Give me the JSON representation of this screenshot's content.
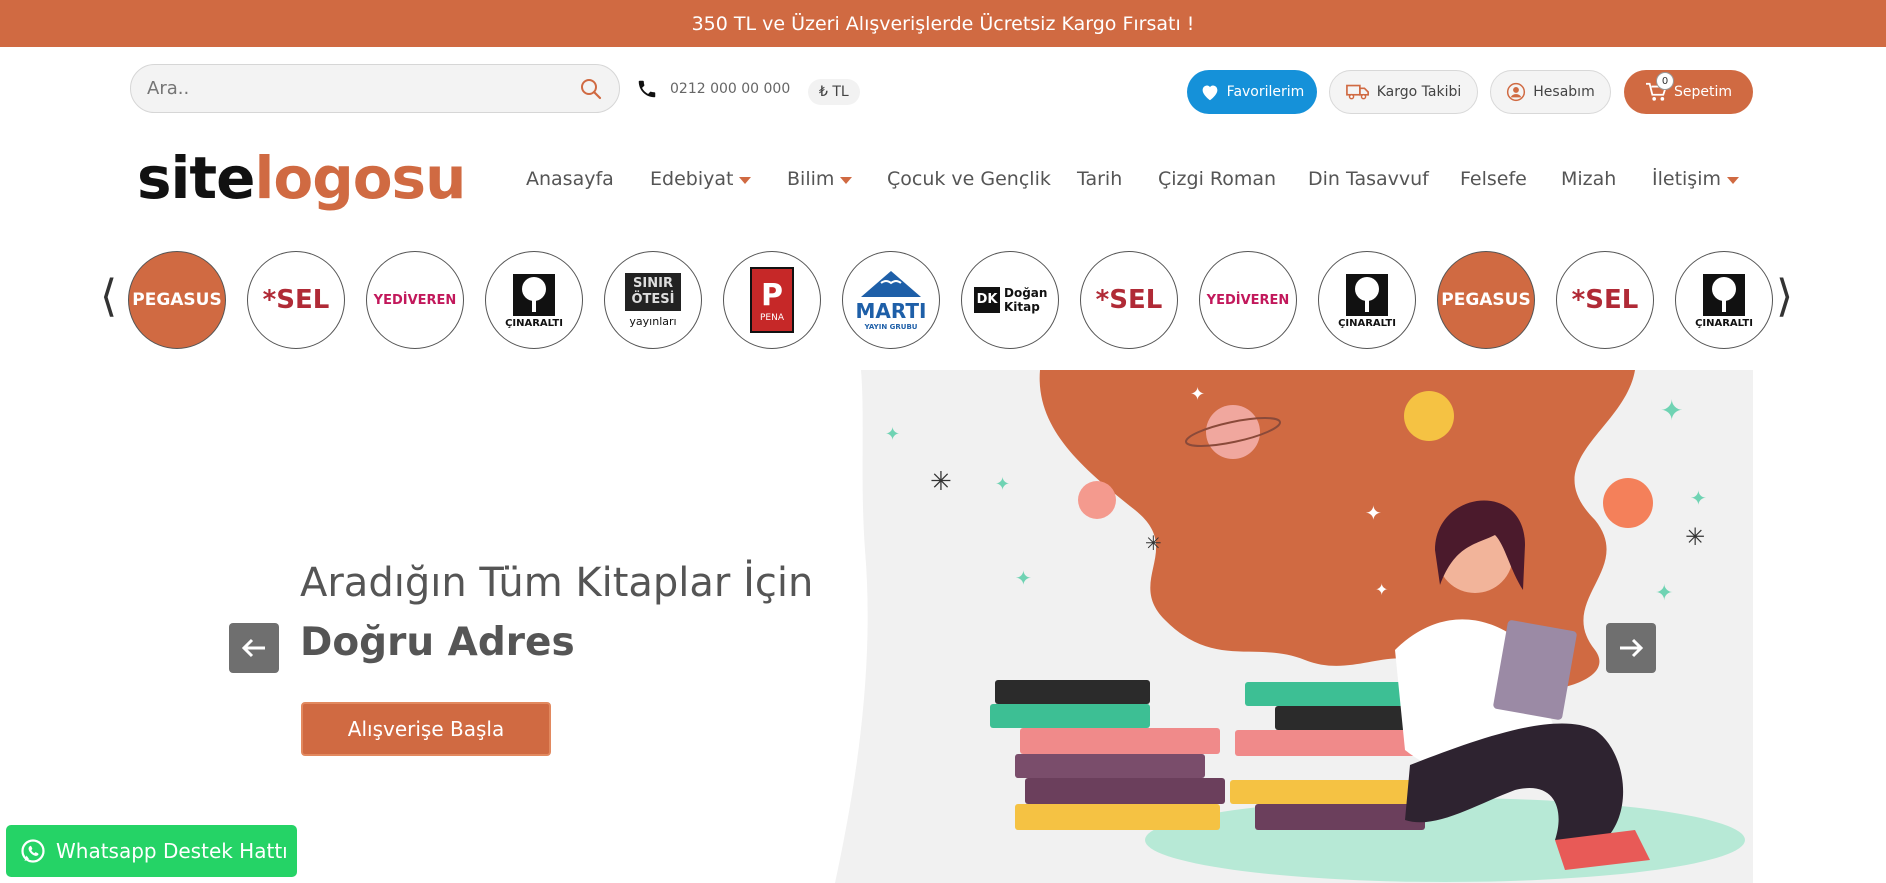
{
  "promo": {
    "text": "350 TL ve Üzeri Alışverişlerde Ücretsiz Kargo Fırsatı !"
  },
  "search": {
    "placeholder": "Ara.."
  },
  "contact": {
    "phone": "0212 000 00 000"
  },
  "currency": {
    "label": "₺ TL"
  },
  "account_bar": {
    "favorites": "Favorilerim",
    "tracking": "Kargo Takibi",
    "account": "Hesabım",
    "cart": "Sepetim",
    "cart_count": "0"
  },
  "logo": {
    "part1": "site",
    "part2": "logosu"
  },
  "nav": [
    {
      "label": "Anasayfa",
      "caret": false
    },
    {
      "label": "Edebiyat",
      "caret": true
    },
    {
      "label": "Bilim",
      "caret": true
    },
    {
      "label": "Çocuk ve Gençlik",
      "caret": false
    },
    {
      "label": "Tarih",
      "caret": false
    },
    {
      "label": "Çizgi Roman",
      "caret": false
    },
    {
      "label": "Din Tasavvuf",
      "caret": false
    },
    {
      "label": "Felsefe",
      "caret": false
    },
    {
      "label": "Mizah",
      "caret": false
    },
    {
      "label": "İletişim",
      "caret": true
    }
  ],
  "brands": [
    {
      "name": "PEGASUS"
    },
    {
      "name": "*SEL"
    },
    {
      "name": "YEDİVEREN"
    },
    {
      "name": "ÇINARALTI"
    },
    {
      "name": "SINIR ÖTESİ",
      "sub": "yayınları"
    },
    {
      "name": "P",
      "sub": "PENA"
    },
    {
      "name": "MARTI",
      "sub": "YAYIN GRUBU"
    },
    {
      "name": "Doğan Kitap"
    },
    {
      "name": "*SEL"
    },
    {
      "name": "YEDİVEREN"
    },
    {
      "name": "ÇINARALTI"
    },
    {
      "name": "PEGASUS"
    },
    {
      "name": "*SEL"
    },
    {
      "name": "ÇINARALTI"
    }
  ],
  "hero": {
    "headline1": "Aradığın Tüm Kitaplar İçin",
    "headline2": "Doğru Adres",
    "cta": "Alışverişe Başla"
  },
  "whatsapp": {
    "label": "Whatsapp Destek Hattı"
  },
  "colors": {
    "brand": "#d06a42",
    "favorite": "#1591d9",
    "whatsapp": "#25d366"
  }
}
